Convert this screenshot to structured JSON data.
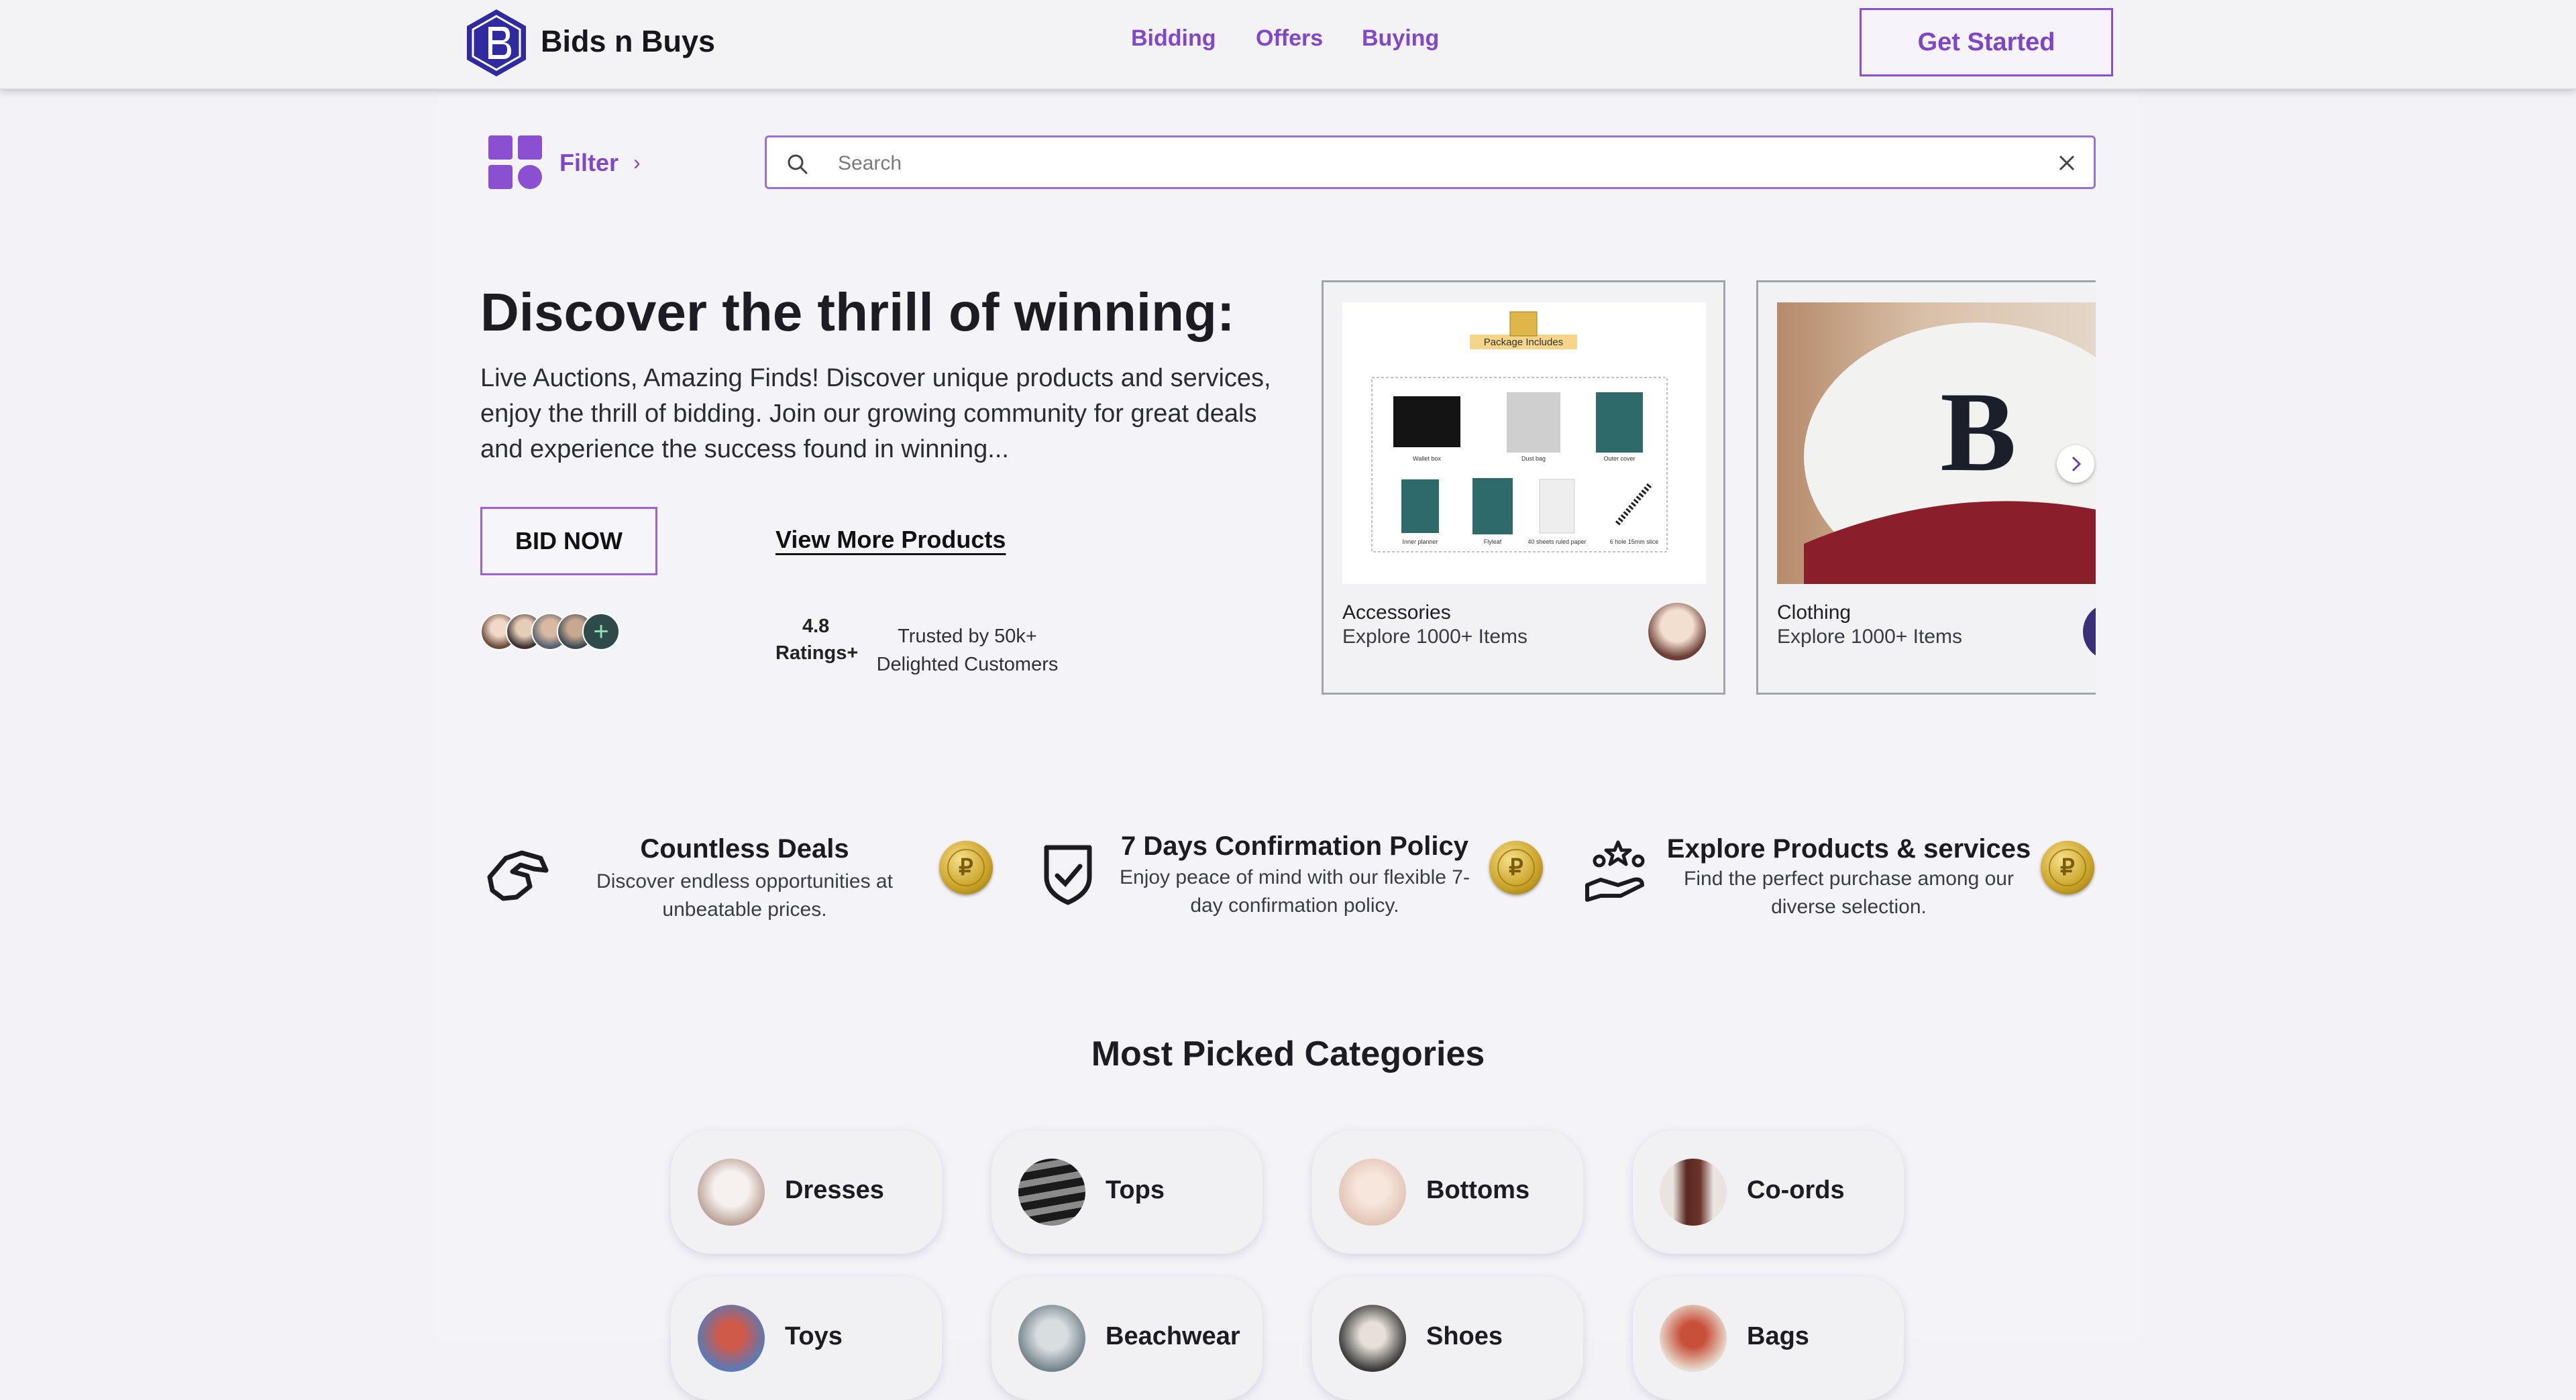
{
  "header": {
    "brand": "Bids n Buys",
    "nav": [
      "Bidding",
      "Offers",
      "Buying"
    ],
    "cta": "Get Started",
    "accent_color": "#8147c9",
    "logo_color": "#2f2aa0"
  },
  "filter": {
    "label": "Filter",
    "icon": "grid-icon",
    "chevron": "chevron-right-icon"
  },
  "search": {
    "placeholder": "Search",
    "value": ""
  },
  "hero": {
    "title": "Discover the thrill of winning:",
    "text": "Live Auctions, Amazing Finds! Discover unique products and services, enjoy the thrill of bidding. Join our growing community for great deals and experience the success found in winning...",
    "primary_button": "BID NOW",
    "secondary_link": "View More Products",
    "rating_value": "4.8",
    "rating_label": "Ratings+",
    "trusted": "Trusted by 50k+ Delighted Customers"
  },
  "products": [
    {
      "name": "Accessories",
      "subtitle": "Explore 1000+ Items",
      "image_caption": "Package Includes",
      "image_labels": [
        "Wallet box",
        "Dust bag",
        "Outer cover",
        "Inner planner",
        "Flyleaf",
        "40 sheets ruled paper",
        "6 hole 15mm slice"
      ]
    },
    {
      "name": "Clothing",
      "subtitle": "Explore 1000+ Items"
    }
  ],
  "features": [
    {
      "title": "Countless Deals",
      "desc": "Discover endless opportunities at unbeatable prices.",
      "icon": "handshake-icon"
    },
    {
      "title": "7 Days Confirmation Policy",
      "desc": "Enjoy peace of mind with our flexible 7-day confirmation policy.",
      "icon": "shield-check-icon"
    },
    {
      "title": "Explore Products & services",
      "desc": "Find the perfect purchase among our diverse selection.",
      "icon": "hand-stars-icon"
    }
  ],
  "coin_symbol": "₽",
  "categories": {
    "heading": "Most Picked Categories",
    "items": [
      "Dresses",
      "Tops",
      "Bottoms",
      "Co-ords",
      "Toys",
      "Beachwear",
      "Shoes",
      "Bags"
    ]
  }
}
